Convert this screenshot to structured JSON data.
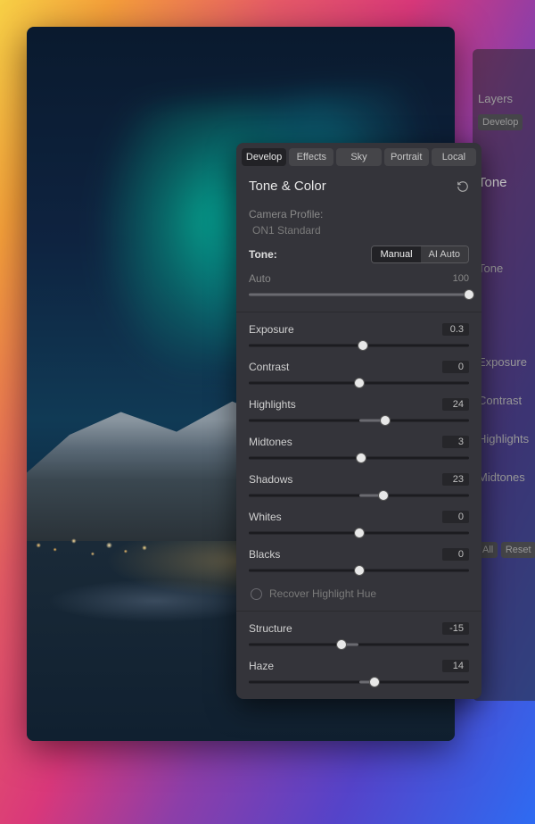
{
  "tabs": [
    {
      "id": "develop",
      "label": "Develop",
      "active": true
    },
    {
      "id": "effects",
      "label": "Effects",
      "active": false
    },
    {
      "id": "sky",
      "label": "Sky",
      "active": false
    },
    {
      "id": "portrait",
      "label": "Portrait",
      "active": false
    },
    {
      "id": "local",
      "label": "Local",
      "active": false
    }
  ],
  "section": {
    "title": "Tone & Color"
  },
  "camera_profile": {
    "label": "Camera Profile:",
    "value": "ON1 Standard"
  },
  "tone_mode": {
    "label": "Tone:",
    "options": [
      {
        "id": "manual",
        "label": "Manual",
        "active": true
      },
      {
        "id": "ai_auto",
        "label": "AI Auto",
        "active": false
      }
    ]
  },
  "auto_slider": {
    "name": "Auto",
    "value": "100",
    "pos": 100
  },
  "sliders_main": [
    {
      "id": "exposure",
      "name": "Exposure",
      "value": "0.3",
      "pos": 52
    },
    {
      "id": "contrast",
      "name": "Contrast",
      "value": "0",
      "pos": 50
    },
    {
      "id": "highlights",
      "name": "Highlights",
      "value": "24",
      "pos": 62
    },
    {
      "id": "midtones",
      "name": "Midtones",
      "value": "3",
      "pos": 51
    },
    {
      "id": "shadows",
      "name": "Shadows",
      "value": "23",
      "pos": 61
    },
    {
      "id": "whites",
      "name": "Whites",
      "value": "0",
      "pos": 50
    },
    {
      "id": "blacks",
      "name": "Blacks",
      "value": "0",
      "pos": 50
    }
  ],
  "recover_highlight": {
    "label": "Recover Highlight Hue",
    "checked": false
  },
  "sliders_detail": [
    {
      "id": "structure",
      "name": "Structure",
      "value": "-15",
      "pos": 42
    },
    {
      "id": "haze",
      "name": "Haze",
      "value": "14",
      "pos": 57
    }
  ],
  "back_panel": {
    "layers_label": "Layers",
    "develop_chip": "Develop",
    "tone_heading": "Tone",
    "tone_label": "Tone",
    "exposure_label": "Exposure",
    "contrast_label": "Contrast",
    "highlights_label": "Highlights",
    "midtones_label": "Midtones",
    "all_label": "All",
    "reset_label": "Reset"
  }
}
